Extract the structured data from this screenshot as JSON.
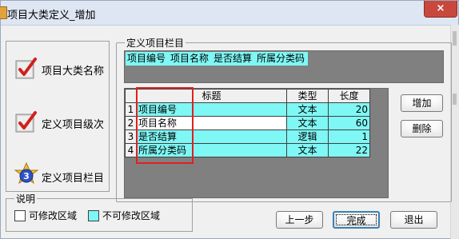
{
  "window": {
    "title": "项目大类定义_增加",
    "close_symbol": "×"
  },
  "sidebar": {
    "items": [
      {
        "label": "项目大类名称",
        "icon": "checkmark-icon"
      },
      {
        "label": "定义项目级次",
        "icon": "checkmark-icon"
      },
      {
        "label": "定义项目栏目",
        "icon": "step-3-icon"
      }
    ]
  },
  "section": {
    "title": "定义项目栏目",
    "preview_columns": [
      "项目编号",
      "项目名称",
      "是否结算",
      "所属分类码"
    ]
  },
  "grid": {
    "headers": [
      "",
      "标题",
      "类型",
      "长度"
    ],
    "rows": [
      {
        "no": "1",
        "title": "项目编号",
        "type": "文本",
        "length": "20",
        "title_editable": false
      },
      {
        "no": "2",
        "title": "项目名称",
        "type": "文本",
        "length": "60",
        "title_editable": true
      },
      {
        "no": "3",
        "title": "是否结算",
        "type": "逻辑",
        "length": "1",
        "title_editable": false
      },
      {
        "no": "4",
        "title": "所属分类码",
        "type": "文本",
        "length": "22",
        "title_editable": false
      }
    ]
  },
  "side_buttons": {
    "add": "增加",
    "delete": "删除"
  },
  "legend": {
    "title": "说明",
    "editable": "可修改区域",
    "non_editable": "不可修改区域"
  },
  "footer": {
    "prev": "上一步",
    "finish": "完成",
    "exit": "退出"
  },
  "colors": {
    "non_editable": "#7ff7f4",
    "editable": "#ffffff",
    "highlight": "#e02020"
  }
}
